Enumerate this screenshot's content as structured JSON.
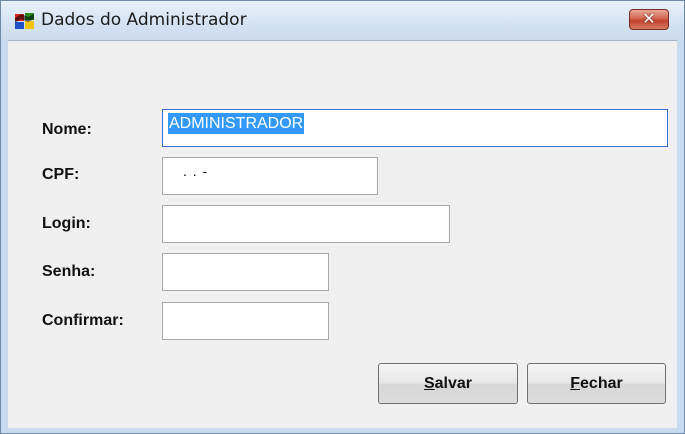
{
  "window": {
    "title": "Dados do Administrador",
    "close_label": "✕"
  },
  "form": {
    "nome_label": "Nome:",
    "nome_value": "ADMINISTRADOR",
    "cpf_label": "CPF:",
    "cpf_value": ".   .   -",
    "login_label": "Login:",
    "login_value": "",
    "senha_label": "Senha:",
    "senha_value": "",
    "confirmar_label": "Confirmar:",
    "confirmar_value": ""
  },
  "buttons": {
    "salvar_accel": "S",
    "salvar_rest": "alvar",
    "fechar_accel": "F",
    "fechar_rest": "echar"
  },
  "colors": {
    "selection": "#3399ff",
    "focus_border": "#3a6fd8",
    "close_button": "#c0432c"
  }
}
